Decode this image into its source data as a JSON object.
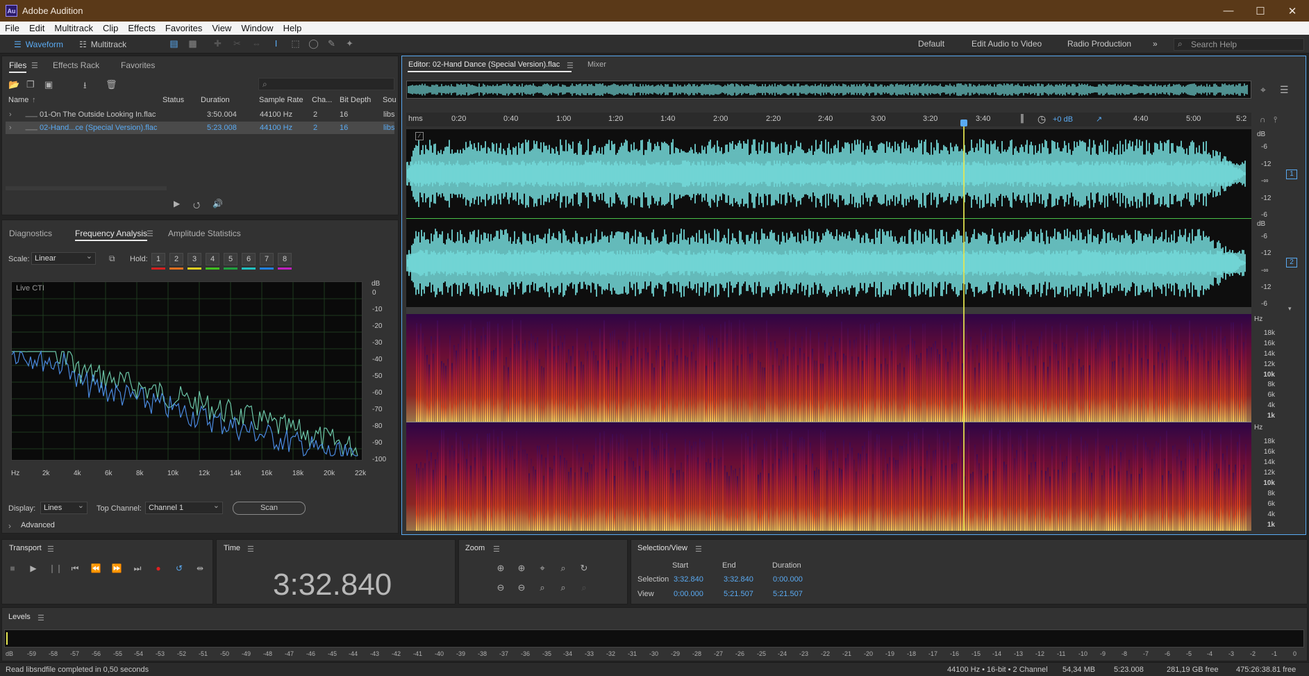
{
  "app": {
    "title": "Adobe Audition",
    "logo": "Au"
  },
  "menu": [
    "File",
    "Edit",
    "Multitrack",
    "Clip",
    "Effects",
    "Favorites",
    "View",
    "Window",
    "Help"
  ],
  "toolbar": {
    "waveform": "Waveform",
    "multitrack": "Multitrack",
    "workspaces": [
      "Default",
      "Edit Audio to Video",
      "Radio Production"
    ],
    "search_placeholder": "Search Help"
  },
  "files_panel": {
    "tabs": [
      "Files",
      "Effects Rack",
      "Favorites"
    ],
    "columns": [
      "Name",
      "Status",
      "Duration",
      "Sample Rate",
      "Cha...",
      "Bit Depth",
      "Sou"
    ],
    "rows": [
      {
        "name": "01-On The Outside Looking In.flac",
        "status": "",
        "duration": "3:50.004",
        "rate": "44100 Hz",
        "ch": "2",
        "bits": "16",
        "src": "libs"
      },
      {
        "name": "02-Hand...ce (Special Version).flac",
        "status": "",
        "duration": "5:23.008",
        "rate": "44100 Hz",
        "ch": "2",
        "bits": "16",
        "src": "libs"
      }
    ]
  },
  "analysis_panel": {
    "tabs": [
      "Diagnostics",
      "Frequency Analysis",
      "Amplitude Statistics"
    ],
    "scale_label": "Scale:",
    "scale_value": "Linear",
    "hold_label": "Hold:",
    "hold_buttons": [
      "1",
      "2",
      "3",
      "4",
      "5",
      "6",
      "7",
      "8"
    ],
    "hold_colors": [
      "#d42020",
      "#e07020",
      "#e0d020",
      "#40c020",
      "#20a040",
      "#20c0c0",
      "#2080e0",
      "#c020c0"
    ],
    "plot_label": "Live CTI",
    "db_unit": "dB",
    "db_ticks": [
      "0",
      "-10",
      "-20",
      "-30",
      "-40",
      "-50",
      "-60",
      "-70",
      "-80",
      "-90",
      "-100"
    ],
    "hz_ticks": [
      "Hz",
      "2k",
      "4k",
      "6k",
      "8k",
      "10k",
      "12k",
      "14k",
      "16k",
      "18k",
      "20k",
      "22k"
    ],
    "display_label": "Display:",
    "display_value": "Lines",
    "top_channel_label": "Top Channel:",
    "top_channel_value": "Channel 1",
    "scan_button": "Scan",
    "advanced": "Advanced"
  },
  "editor": {
    "tab": "Editor: 02-Hand Dance (Special Version).flac",
    "mixer_tab": "Mixer",
    "ruler_unit": "hms",
    "ruler_ticks": [
      "0:20",
      "0:40",
      "1:00",
      "1:20",
      "1:40",
      "2:00",
      "2:20",
      "2:40",
      "3:00",
      "3:20",
      "3:40",
      "4:40",
      "5:00",
      "5:2"
    ],
    "gain": "+0 dB",
    "db_unit": "dB",
    "db_ticks": [
      "-6",
      "-12",
      "-∞",
      "-12",
      "-6"
    ],
    "channel_badges": [
      "1",
      "2"
    ],
    "hz_unit": "Hz",
    "hz_ticks": [
      "18k",
      "16k",
      "14k",
      "12k",
      "10k",
      "8k",
      "6k",
      "4k",
      "1k"
    ]
  },
  "transport": {
    "title": "Transport"
  },
  "time": {
    "title": "Time",
    "value": "3:32.840"
  },
  "zoom": {
    "title": "Zoom"
  },
  "selection_view": {
    "title": "Selection/View",
    "headers": [
      "Start",
      "End",
      "Duration"
    ],
    "rows": [
      {
        "label": "Selection",
        "start": "3:32.840",
        "end": "3:32.840",
        "duration": "0:00.000"
      },
      {
        "label": "View",
        "start": "0:00.000",
        "end": "5:21.507",
        "duration": "5:21.507"
      }
    ]
  },
  "levels": {
    "title": "Levels",
    "ticks": [
      "dB",
      "-59",
      "-58",
      "-57",
      "-56",
      "-55",
      "-54",
      "-53",
      "-52",
      "-51",
      "-50",
      "-49",
      "-48",
      "-47",
      "-46",
      "-45",
      "-44",
      "-43",
      "-42",
      "-41",
      "-40",
      "-39",
      "-38",
      "-37",
      "-36",
      "-35",
      "-34",
      "-33",
      "-32",
      "-31",
      "-30",
      "-29",
      "-28",
      "-27",
      "-26",
      "-25",
      "-24",
      "-23",
      "-22",
      "-21",
      "-20",
      "-19",
      "-18",
      "-17",
      "-16",
      "-15",
      "-14",
      "-13",
      "-12",
      "-11",
      "-10",
      "-9",
      "-8",
      "-7",
      "-6",
      "-5",
      "-4",
      "-3",
      "-2",
      "-1",
      "0"
    ]
  },
  "status": {
    "message": "Read libsndfile completed in 0,50 seconds",
    "format": "44100 Hz • 16-bit • 2 Channel",
    "size": "54,34 MB",
    "duration": "5:23.008",
    "free": "281,19 GB free",
    "free_time": "475:26:38.81 free"
  },
  "colors": {
    "accent": "#5aaaf2",
    "waveform": "#7ae6e6",
    "playhead": "#e6e650"
  }
}
